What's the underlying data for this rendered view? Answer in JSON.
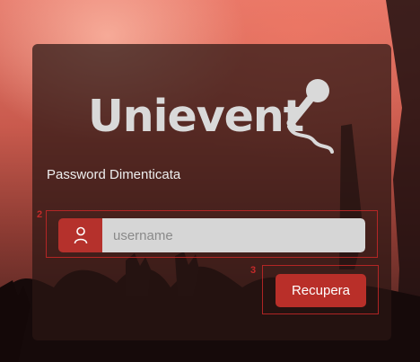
{
  "background": {
    "image": "concert-crowd-background"
  },
  "logo": {
    "text": "Unievent",
    "icon": "microphone-icon"
  },
  "form": {
    "title": "Password Dimenticata",
    "username_placeholder": "username",
    "username_value": "",
    "user_icon": "user-icon",
    "submit_label": "Recupera"
  },
  "annotations": {
    "input_marker": "2",
    "button_marker": "3"
  },
  "colors": {
    "accent": "#b92f29",
    "panel": "#2a1614",
    "input_bg": "#d6d6d6",
    "annotation": "#c42a2a"
  }
}
